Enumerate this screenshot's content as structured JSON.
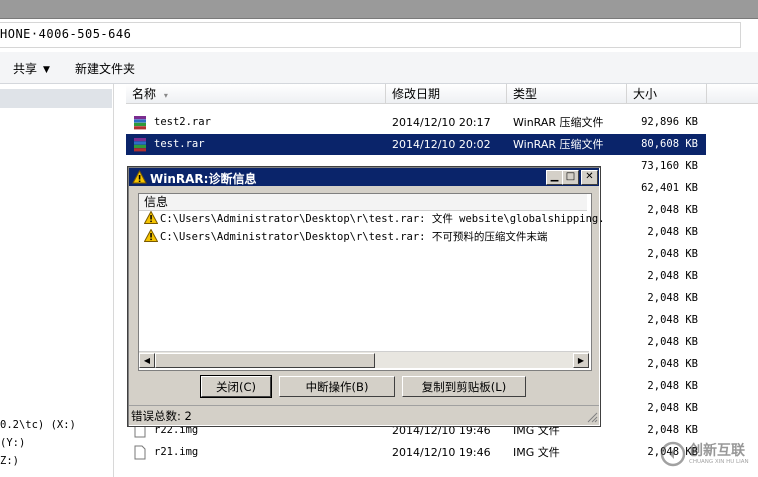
{
  "address_bar": {
    "text": "HONE·4006-505-646"
  },
  "toolbar": {
    "share_label": "共享",
    "new_folder_label": "新建文件夹"
  },
  "nav": {
    "drives": [
      {
        "label": "0.2\\tc) (X:)"
      },
      {
        "label": "(Y:)"
      },
      {
        "label": "Z:)"
      }
    ]
  },
  "columns": {
    "name": "名称",
    "date": "修改日期",
    "type": "类型",
    "size": "大小"
  },
  "files": [
    {
      "name": "test2.rar",
      "date": "2014/12/10 20:17",
      "type": "WinRAR 压缩文件",
      "size": "92,896 KB",
      "icon": "winrar-icon"
    },
    {
      "name": "test.rar",
      "date": "2014/12/10 20:02",
      "type": "WinRAR 压缩文件",
      "size": "80,608 KB",
      "icon": "winrar-icon",
      "selected": true
    },
    {
      "name": "",
      "date": "",
      "type": "",
      "size": "73,160 KB"
    },
    {
      "name": "",
      "date": "",
      "type": "",
      "size": "62,401 KB"
    },
    {
      "name": "",
      "date": "",
      "type": "",
      "size": "2,048 KB"
    },
    {
      "name": "",
      "date": "",
      "type": "",
      "size": "2,048 KB"
    },
    {
      "name": "",
      "date": "",
      "type": "",
      "size": "2,048 KB"
    },
    {
      "name": "",
      "date": "",
      "type": "",
      "size": "2,048 KB"
    },
    {
      "name": "",
      "date": "",
      "type": "",
      "size": "2,048 KB"
    },
    {
      "name": "",
      "date": "",
      "type": "",
      "size": "2,048 KB"
    },
    {
      "name": "",
      "date": "",
      "type": "",
      "size": "2,048 KB"
    },
    {
      "name": "",
      "date": "",
      "type": "",
      "size": "2,048 KB"
    },
    {
      "name": "",
      "date": "",
      "type": "",
      "size": "2,048 KB"
    },
    {
      "name": "",
      "date": "",
      "type": "",
      "size": "2,048 KB"
    },
    {
      "name": "r22.img",
      "date": "2014/12/10 19:46",
      "type": "IMG 文件",
      "size": "2,048 KB",
      "icon": "file-icon"
    },
    {
      "name": "r21.img",
      "date": "2014/12/10 19:46",
      "type": "IMG 文件",
      "size": "2,048 KB",
      "icon": "file-icon"
    }
  ],
  "dialog": {
    "title": "WinRAR:诊断信息",
    "list_header": "信息",
    "messages": [
      "C:\\Users\\Administrator\\Desktop\\r\\test.rar: 文件 website\\globalshipping.",
      "C:\\Users\\Administrator\\Desktop\\r\\test.rar: 不可预料的压缩文件末端"
    ],
    "close_label": "关闭(C)",
    "abort_label": "中断操作(B)",
    "copy_label": "复制到剪贴板(L)",
    "status": "错误总数: 2"
  },
  "watermark": {
    "text": "创新互联",
    "subtext": "CHUANG XIN HU LIAN"
  }
}
